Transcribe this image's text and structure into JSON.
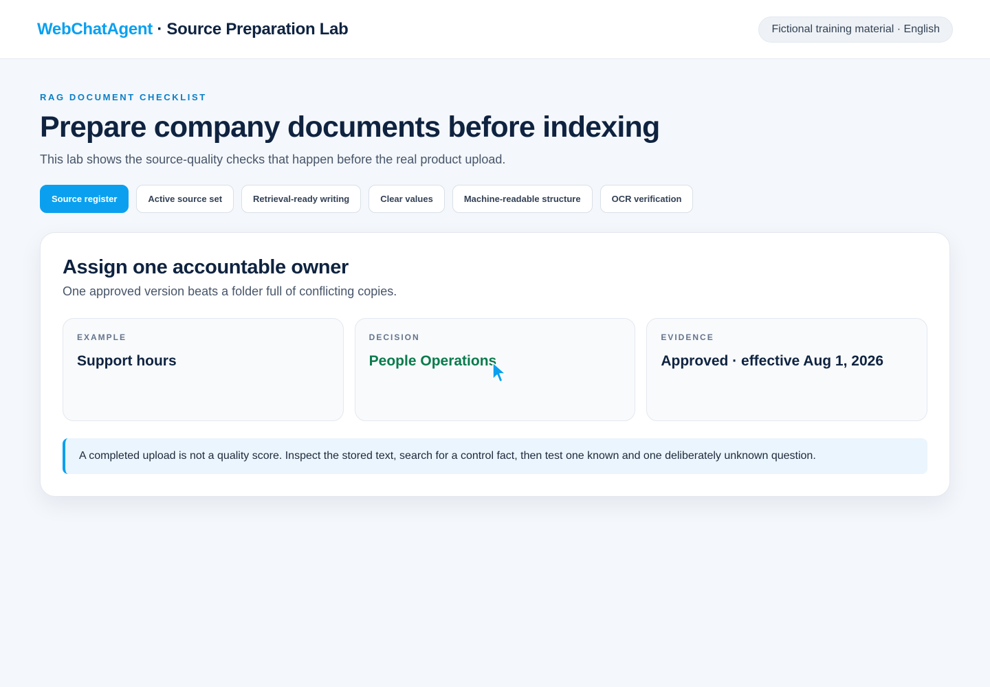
{
  "header": {
    "brand_name": "WebChatAgent",
    "brand_separator": " · ",
    "brand_lab": "Source Preparation Lab",
    "badge": "Fictional training material · English"
  },
  "hero": {
    "eyebrow": "RAG DOCUMENT CHECKLIST",
    "title": "Prepare company documents before indexing",
    "subtitle": "This lab shows the source-quality checks that happen before the real product upload."
  },
  "tabs": [
    {
      "label": "Source register",
      "active": true
    },
    {
      "label": "Active source set",
      "active": false
    },
    {
      "label": "Retrieval-ready writing",
      "active": false
    },
    {
      "label": "Clear values",
      "active": false
    },
    {
      "label": "Machine-readable structure",
      "active": false
    },
    {
      "label": "OCR verification",
      "active": false
    }
  ],
  "panel": {
    "title": "Assign one accountable owner",
    "subtitle": "One approved version beats a folder full of conflicting copies.",
    "columns": [
      {
        "label": "EXAMPLE",
        "value": "Support hours"
      },
      {
        "label": "DECISION",
        "value": "People Operations"
      },
      {
        "label": "EVIDENCE",
        "value": "Approved · effective Aug 1, 2026"
      }
    ],
    "note": "A completed upload is not a quality score. Inspect the stored text, search for a control fact, then test one known and one deliberately unknown question."
  },
  "icons": {
    "cursor": "mouse-pointer-icon"
  },
  "colors": {
    "accent": "#0aa0ef",
    "decision": "#0a7a4c",
    "text": "#0f2340"
  }
}
